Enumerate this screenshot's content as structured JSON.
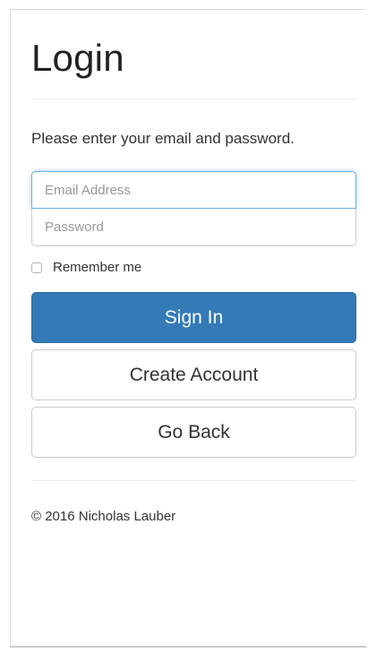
{
  "page": {
    "title": "Login",
    "intro": "Please enter your email and password."
  },
  "form": {
    "email_placeholder": "Email Address",
    "email_value": "",
    "password_placeholder": "Password",
    "password_value": "",
    "remember_label": "Remember me",
    "remember_checked": false
  },
  "buttons": {
    "sign_in": "Sign In",
    "create_account": "Create Account",
    "go_back": "Go Back"
  },
  "footer": {
    "copyright": "© 2016 Nicholas Lauber"
  },
  "colors": {
    "primary": "#337ab7",
    "focus_border": "#66afe9",
    "text": "#333333",
    "placeholder": "#999999"
  }
}
